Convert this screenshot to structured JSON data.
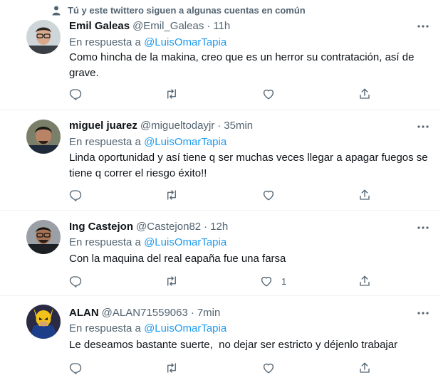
{
  "social_context": "Tú y este twittero siguen a algunas cuentas en común",
  "reply_prefix": "En respuesta a",
  "tweets": [
    {
      "name": "Emil Galeas",
      "handle": "@Emil_Galeas",
      "separator": "·",
      "time": "11h",
      "mention": "@LuisOmarTapia",
      "text": "Como hincha de la makina, creo que es un herror su contratación, así de grave.",
      "like_count": ""
    },
    {
      "name": "miguel juarez",
      "handle": "@migueltodayjr",
      "separator": "·",
      "time": "35min",
      "mention": "@LuisOmarTapia",
      "text": "Linda oportunidad y así tiene q ser muchas veces llegar a apagar fuegos se tiene q correr el riesgo éxito!!",
      "like_count": ""
    },
    {
      "name": "Ing Castejon",
      "handle": "@Castejon82",
      "separator": "·",
      "time": "12h",
      "mention": "@LuisOmarTapia",
      "text": "Con la maquina del real eapaña fue una farsa",
      "like_count": "1"
    },
    {
      "name": "ALAN",
      "handle": "@ALAN71559063",
      "separator": "·",
      "time": "7min",
      "mention": "@LuisOmarTapia",
      "text": "Le deseamos bastante suerte,  no dejar ser estricto y déjenlo trabajar",
      "like_count": ""
    }
  ],
  "icons": {
    "social": "person-icon",
    "more": "more-icon",
    "reply": "reply-icon",
    "retweet": "retweet-icon",
    "like": "like-icon",
    "share": "share-icon"
  },
  "colors": {
    "link": "#1d9bf0",
    "secondary_text": "#536471",
    "primary_text": "#0f1419",
    "divider": "#eff3f4"
  }
}
